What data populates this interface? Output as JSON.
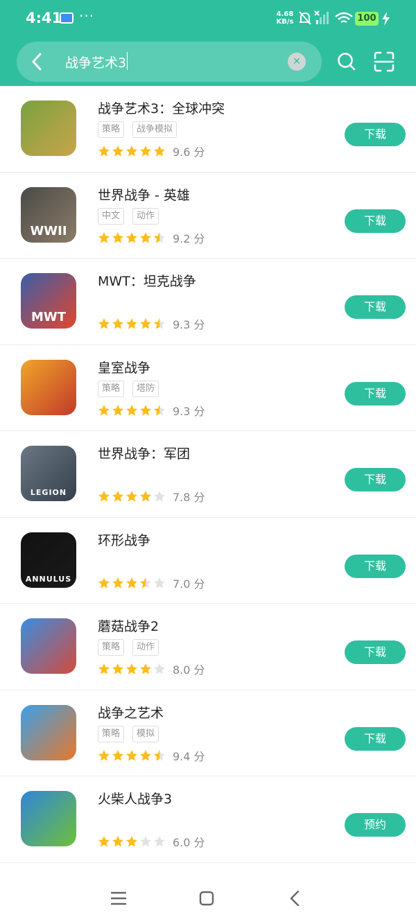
{
  "status": {
    "time": "4:41",
    "dots": "···",
    "speed_value": "4.68",
    "speed_unit": "KB/s",
    "battery": "100"
  },
  "search": {
    "query": "战争艺术3"
  },
  "apps": [
    {
      "name": "战争艺术3：全球冲突",
      "tags": [
        "策略",
        "战争模拟"
      ],
      "stars": 5,
      "score": "9.6 分",
      "button": "下载",
      "icon_colors": [
        "#7aa23f",
        "#c9a44a"
      ]
    },
    {
      "name": "世界战争 - 英雄",
      "tags": [
        "中文",
        "动作"
      ],
      "stars": 4.5,
      "score": "9.2 分",
      "button": "下载",
      "icon_colors": [
        "#4a4a48",
        "#8c7c68"
      ],
      "icon_text": "WWII"
    },
    {
      "name": "MWT：坦克战争",
      "tags": [],
      "stars": 4.5,
      "score": "9.3 分",
      "button": "下载",
      "icon_colors": [
        "#3b5ea8",
        "#e2452d"
      ],
      "icon_text": "MWT"
    },
    {
      "name": "皇室战争",
      "tags": [
        "策略",
        "塔防"
      ],
      "stars": 4.5,
      "score": "9.3 分",
      "button": "下载",
      "icon_colors": [
        "#f0a52a",
        "#c23a2a"
      ]
    },
    {
      "name": "世界战争：军团",
      "tags": [],
      "stars": 4,
      "score": "7.8 分",
      "button": "下载",
      "icon_colors": [
        "#6a7784",
        "#34414b"
      ],
      "icon_text": "LEGION"
    },
    {
      "name": "环形战争",
      "tags": [],
      "stars": 3.5,
      "score": "7.0 分",
      "button": "下载",
      "icon_colors": [
        "#111111",
        "#1a1a1a"
      ],
      "icon_text": "ANNULUS"
    },
    {
      "name": "蘑菇战争2",
      "tags": [
        "策略",
        "动作"
      ],
      "stars": 4,
      "score": "8.0 分",
      "button": "下载",
      "icon_colors": [
        "#3a8ee0",
        "#d44a3c"
      ]
    },
    {
      "name": "战争之艺术",
      "tags": [
        "策略",
        "模拟"
      ],
      "stars": 4.5,
      "score": "9.4 分",
      "button": "下载",
      "icon_colors": [
        "#3aa0e8",
        "#e8782a"
      ]
    },
    {
      "name": "火柴人战争3",
      "tags": [],
      "stars": 3,
      "score": "6.0 分",
      "button": "预约",
      "icon_colors": [
        "#2f86d9",
        "#6fbf3a"
      ]
    }
  ],
  "colors": {
    "accent": "#2ebf9f",
    "star": "#fcbc1a",
    "star_empty": "#e2e2e2"
  }
}
